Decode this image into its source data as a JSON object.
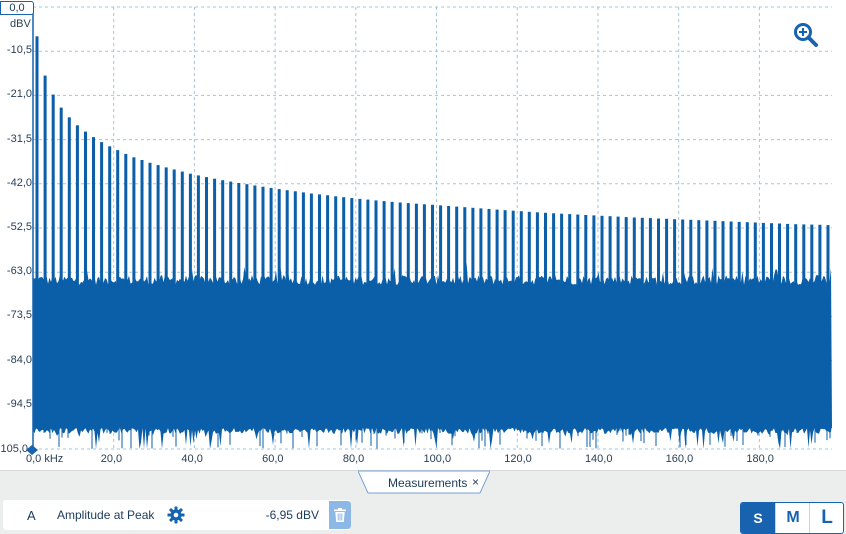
{
  "plot": {
    "y_unit": "dBV",
    "y_max_label": "0,0",
    "x_unit_label": "0,0 kHz",
    "y_ticks": [
      "-10,5",
      "-21,0",
      "-31,5",
      "-42,0",
      "-52,5",
      "-63,0",
      "-73,5",
      "-84,0",
      "-94,5",
      "-105,0"
    ],
    "x_ticks": [
      "20,0",
      "40,0",
      "60,0",
      "80,0",
      "100,0",
      "120,0",
      "140,0",
      "160,0",
      "180,0"
    ],
    "zoom_icon": "zoom-in-icon"
  },
  "chart_data": {
    "type": "line",
    "title": "",
    "xlabel": "kHz",
    "ylabel": "dBV",
    "xlim": [
      0,
      198
    ],
    "ylim": [
      -105,
      0
    ],
    "grid": true,
    "series": [
      {
        "name": "",
        "color": "#0b5ea8",
        "harmonic_spacing_khz": 2.0,
        "noise_floor_band_dbv": [
          -66,
          -100
        ],
        "harmonic_peaks": {
          "x": [
            1,
            3,
            5,
            7,
            9,
            11,
            13,
            15,
            17,
            19,
            21,
            23,
            25,
            29,
            33,
            39,
            45,
            51,
            59,
            69,
            79,
            89,
            99,
            109,
            119,
            129,
            139,
            149,
            159,
            169,
            179,
            189,
            197
          ],
          "y": [
            -6.95,
            -16.3,
            -20.8,
            -23.9,
            -26.2,
            -28.1,
            -29.6,
            -30.9,
            -32.1,
            -33.1,
            -34.0,
            -34.9,
            -35.7,
            -37.0,
            -38.1,
            -39.6,
            -40.8,
            -41.8,
            -43.0,
            -44.3,
            -45.4,
            -46.3,
            -47.0,
            -47.7,
            -48.4,
            -49.0,
            -49.5,
            -50.0,
            -50.4,
            -50.8,
            -51.2,
            -51.6,
            -51.8
          ]
        }
      }
    ]
  },
  "measurements_tab": {
    "label": "Measurements",
    "close_glyph": "×"
  },
  "measurement": {
    "channel": "A",
    "name": "Amplitude at Peak",
    "value": "-6,95 dBV",
    "gear_icon": "gear-icon",
    "delete_icon": "trash-icon"
  },
  "size_buttons": {
    "s": "S",
    "m": "M",
    "l": "L",
    "active": "S"
  }
}
